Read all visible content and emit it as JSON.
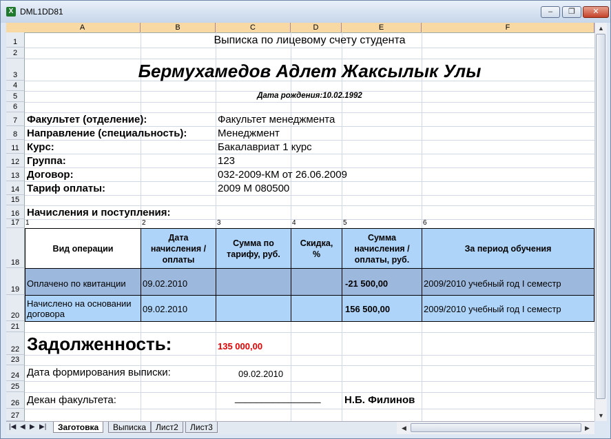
{
  "window": {
    "title": "DML1DD81",
    "minimize_label": "–",
    "restore_label": "❐",
    "close_label": "✕"
  },
  "columns": [
    "A",
    "B",
    "C",
    "D",
    "E",
    "F"
  ],
  "rows": [
    "1",
    "2",
    "3",
    "4",
    "5",
    "6",
    "7",
    "8",
    "11",
    "12",
    "13",
    "14",
    "15",
    "16",
    "17",
    "18",
    "19",
    "20",
    "21",
    "22",
    "23",
    "24",
    "25",
    "26",
    "27"
  ],
  "doc": {
    "heading": "Выписка по лицевому счету студента",
    "student_name": "Бермухамедов Адлет Жаксылык Улы",
    "birth_date": "Дата рождения:10.02.1992",
    "fields": [
      {
        "label": "Факультет (отделение):",
        "value": "Факультет менеджмента"
      },
      {
        "label": "Направление (специальность):",
        "value": "Менеджмент"
      },
      {
        "label": "Курс:",
        "value": "Бакалавриат 1 курс"
      },
      {
        "label": "Группа:",
        "value": "123"
      },
      {
        "label": "Договор:",
        "value": "032-2009-КМ от 26.06.2009"
      },
      {
        "label": "Тариф оплаты:",
        "value": "2009 М 080500"
      }
    ],
    "section_title": "Начисления и поступления:",
    "col_numbers": [
      "1",
      "2",
      "3",
      "4",
      "5",
      "6"
    ],
    "table_headers": [
      "Вид операции",
      "Дата начисления / оплаты",
      "Сумма по тарифу, руб.",
      "Скидка, %",
      "Сумма начисления / оплаты, руб.",
      "За период обучения"
    ],
    "table_rows": [
      {
        "operation": "Оплачено по квитанции",
        "date": "09.02.2010",
        "tariff": "",
        "discount": "",
        "amount": "-21 500,00",
        "period": "2009/2010 учебный год I семестр"
      },
      {
        "operation": "Начислено на основании договора",
        "date": "09.02.2010",
        "tariff": "",
        "discount": "",
        "amount": "156 500,00",
        "period": "2009/2010 учебный год I семестр"
      }
    ],
    "debt_label": "Задолженность:",
    "debt_value": "135 000,00",
    "debt_color": "#e00000",
    "issue_date_label": "Дата формирования выписки:",
    "issue_date_value": "09.02.2010",
    "dean_label": "Декан факультета:",
    "dean_line": "________________",
    "dean_name": "Н.Б. Филинов"
  },
  "tabs": [
    "Заготовка",
    "Выписка",
    "Лист2",
    "Лист3"
  ],
  "active_tab": "Заготовка"
}
